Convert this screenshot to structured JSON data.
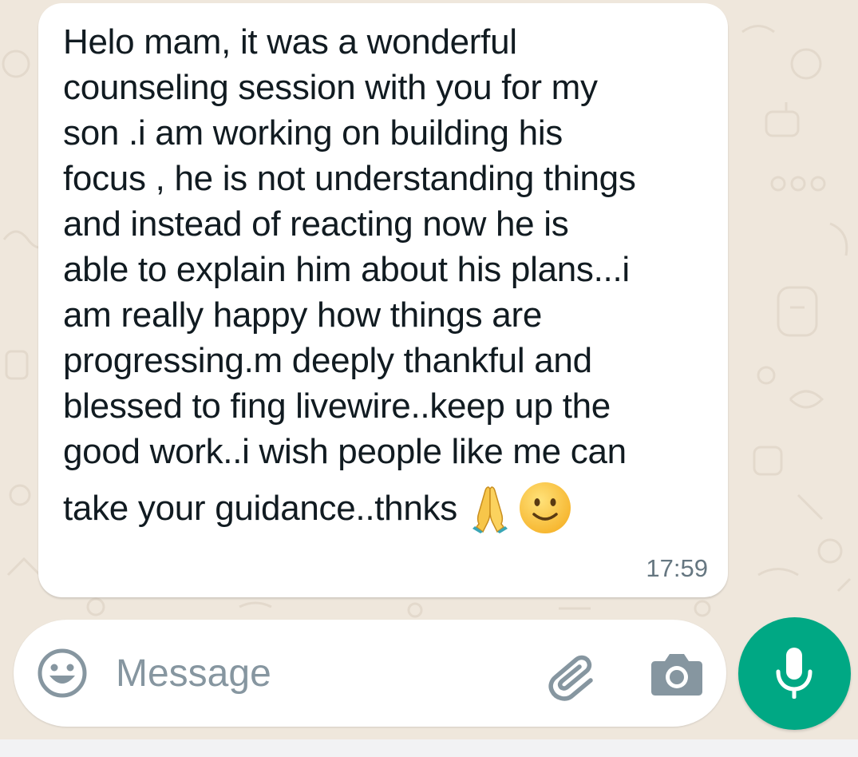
{
  "conversation": {
    "message": {
      "lines": [
        "Helo mam, it was a wonderful",
        "counseling session with you for my",
        "son .i am working on building his",
        "focus , he is not understanding things",
        "and  instead of reacting now he is",
        "able to explain him about his plans...i",
        "am really happy how things are",
        "progressing.m deeply thankful and",
        "blessed to fing livewire..keep up the",
        "good work..i wish people like me can"
      ],
      "last_line": "take your guidance..thnks",
      "emojis": [
        "folded-hands-emoji",
        "smiling-face-emoji"
      ],
      "time": "17:59"
    }
  },
  "composer": {
    "placeholder": "Message",
    "icons": {
      "emoji": "emoji-icon",
      "attach": "paperclip-icon",
      "camera": "camera-icon",
      "mic": "microphone-icon"
    }
  },
  "colors": {
    "wallpaper": "#efe7dc",
    "bubble": "#ffffff",
    "text": "#111b21",
    "meta": "#667781",
    "icon": "#8696a0",
    "accent": "#00a884"
  }
}
